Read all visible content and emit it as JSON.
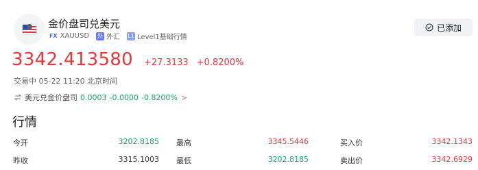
{
  "header": {
    "title": "金价盘司兑美元",
    "fx_tag": "FX",
    "symbol": "XAUUSD",
    "tag1_icon": "外",
    "tag1": "外汇",
    "tag2_icon": "L1",
    "tag2": "Level1基础行情",
    "added_label": "已添加"
  },
  "quote": {
    "price": "3342.413580",
    "change": "+27.3133",
    "change_pct": "+0.8200%",
    "status": "交易中 05-22 11:20 北京时间"
  },
  "related": {
    "name": "美元兑金价盘司",
    "price": "0.0003",
    "change": "-0.0000",
    "pct": "-0.8200%",
    "arrow": ">"
  },
  "market": {
    "title": "行情",
    "stats": [
      {
        "label": "今开",
        "value": "3202.8185"
      },
      {
        "label": "最高",
        "value": "3345.5446"
      },
      {
        "label": "买入价",
        "value": "3342.1343"
      },
      {
        "label": "昨收",
        "value": "3315.1003"
      },
      {
        "label": "最低",
        "value": "3202.8185"
      },
      {
        "label": "卖出价",
        "value": "3342.6929"
      }
    ]
  },
  "colors": {
    "up": "#e8343b",
    "down": "#13a36f",
    "accent": "#4f6df5"
  }
}
